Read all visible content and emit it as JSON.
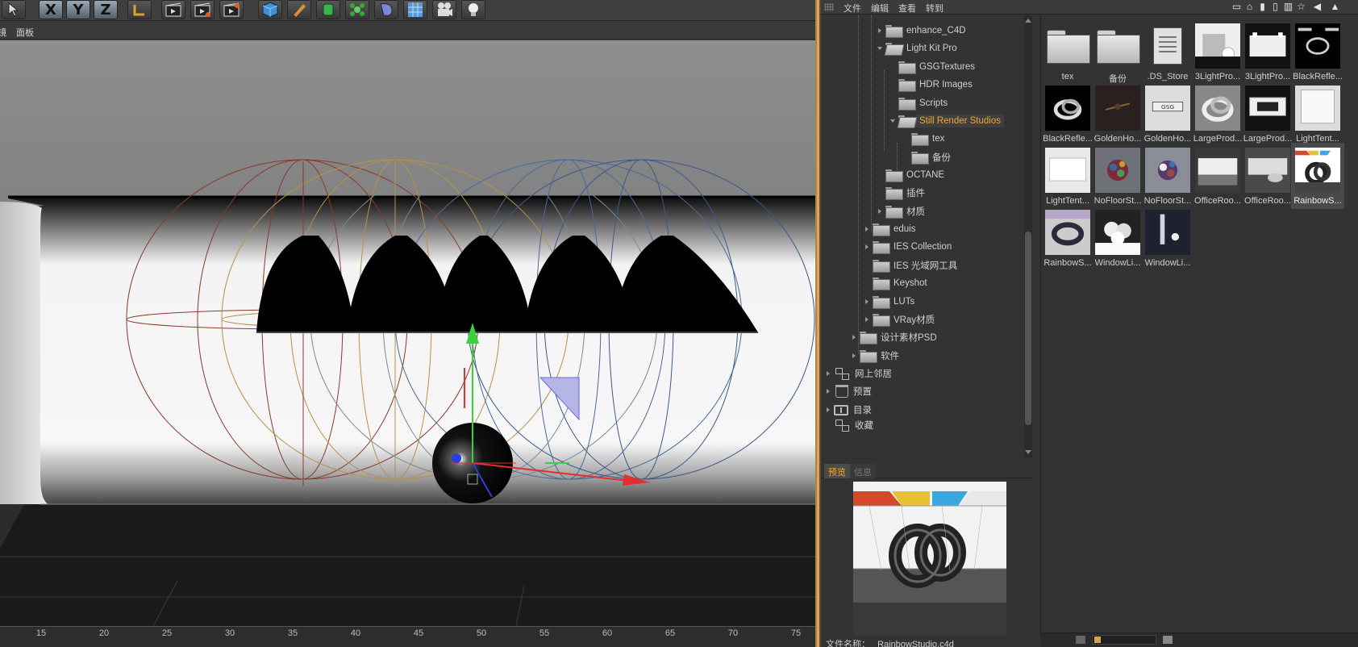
{
  "viewport": {
    "toolbar": {
      "axis_x": "X",
      "axis_y": "Y",
      "axis_z": "Z",
      "tools": [
        "select-icon",
        "coord-icon",
        "render-region-icon",
        "render-view-icon",
        "render-settings-icon",
        "cube-icon",
        "pen-icon",
        "generator-icon",
        "deformer-icon",
        "environment-icon",
        "floor-icon",
        "camera-icon",
        "light-icon"
      ]
    },
    "menu": {
      "item_partial": "镜",
      "panel": "面板"
    },
    "ruler_ticks": [
      "15",
      "20",
      "25",
      "30",
      "35",
      "40",
      "45",
      "50",
      "55",
      "60",
      "65",
      "70",
      "75"
    ]
  },
  "browser": {
    "menu": {
      "file": "文件",
      "edit": "编辑",
      "view": "查看",
      "goto": "转到"
    },
    "tree": [
      {
        "label": "enhance_C4D",
        "indent": 2,
        "open": false
      },
      {
        "label": "Light Kit Pro",
        "indent": 2,
        "open": true
      },
      {
        "label": "GSGTextures",
        "indent": 3,
        "open": false
      },
      {
        "label": "HDR Images",
        "indent": 3,
        "open": false
      },
      {
        "label": "Scripts",
        "indent": 3,
        "open": false
      },
      {
        "label": "Still Render Studios",
        "indent": 3,
        "open": true,
        "selected": true
      },
      {
        "label": "tex",
        "indent": 4,
        "open": false
      },
      {
        "label": "备份",
        "indent": 4,
        "open": false
      },
      {
        "label": "OCTANE",
        "indent": 2,
        "open": false
      },
      {
        "label": "插件",
        "indent": 2,
        "open": false
      },
      {
        "label": "材质",
        "indent": 2,
        "open": false
      },
      {
        "label": "eduis",
        "indent": 1,
        "open": false
      },
      {
        "label": "IES Collection",
        "indent": 1,
        "open": false
      },
      {
        "label": "IES 光域网工具",
        "indent": 1,
        "open": false
      },
      {
        "label": "Keyshot",
        "indent": 1,
        "open": false
      },
      {
        "label": "LUTs",
        "indent": 1,
        "open": false
      },
      {
        "label": "VRay材质",
        "indent": 1,
        "open": false
      },
      {
        "label": "设计素材PSD",
        "indent": 0,
        "open": false
      },
      {
        "label": "软件",
        "indent": 0,
        "open": false
      }
    ],
    "roots": [
      {
        "label": "网上邻居",
        "icon": "network-icon"
      },
      {
        "label": "预置",
        "icon": "presets-icon"
      },
      {
        "label": "目录",
        "icon": "catalog-icon"
      },
      {
        "label": "收藏",
        "icon": "favorites-icon"
      }
    ],
    "grid": [
      {
        "caption": "tex",
        "kind": "folder"
      },
      {
        "caption": "备份",
        "kind": "folder"
      },
      {
        "caption": ".DS_Store",
        "kind": "doc"
      },
      {
        "caption": "3LightPro...",
        "kind": "thumb",
        "thumb": "light-room"
      },
      {
        "caption": "3LightPro...",
        "kind": "thumb",
        "thumb": "light-studio"
      },
      {
        "caption": "BlackRefle...",
        "kind": "thumb",
        "thumb": "black-knot"
      },
      {
        "caption": "BlackRefle...",
        "kind": "thumb",
        "thumb": "black-knot2"
      },
      {
        "caption": "GoldenHo...",
        "kind": "thumb",
        "thumb": "golden-dark"
      },
      {
        "caption": "GoldenHo...",
        "kind": "thumb",
        "thumb": "golden-logo"
      },
      {
        "caption": "LargeProd...",
        "kind": "thumb",
        "thumb": "large-knot"
      },
      {
        "caption": "LargeProd...",
        "kind": "thumb",
        "thumb": "large-studio"
      },
      {
        "caption": "LightTent...",
        "kind": "thumb",
        "thumb": "tent"
      },
      {
        "caption": "LightTent...",
        "kind": "thumb",
        "thumb": "tent2"
      },
      {
        "caption": "NoFloorSt...",
        "kind": "thumb",
        "thumb": "nofloor"
      },
      {
        "caption": "NoFloorSt...",
        "kind": "thumb",
        "thumb": "nofloor2"
      },
      {
        "caption": "OfficeRoo...",
        "kind": "thumb",
        "thumb": "office"
      },
      {
        "caption": "OfficeRoo...",
        "kind": "thumb",
        "thumb": "office2"
      },
      {
        "caption": "RainbowS...",
        "kind": "thumb",
        "thumb": "rainbow",
        "selected": true
      },
      {
        "caption": "RainbowS...",
        "kind": "thumb",
        "thumb": "rainbow2"
      },
      {
        "caption": "WindowLi...",
        "kind": "thumb",
        "thumb": "window"
      },
      {
        "caption": "WindowLi...",
        "kind": "thumb",
        "thumb": "window2"
      }
    ],
    "preview_tabs": {
      "preview": "预览",
      "info": "信息"
    },
    "filename_label": "文件名称：",
    "filename_value": "RainbowStudio.c4d"
  }
}
